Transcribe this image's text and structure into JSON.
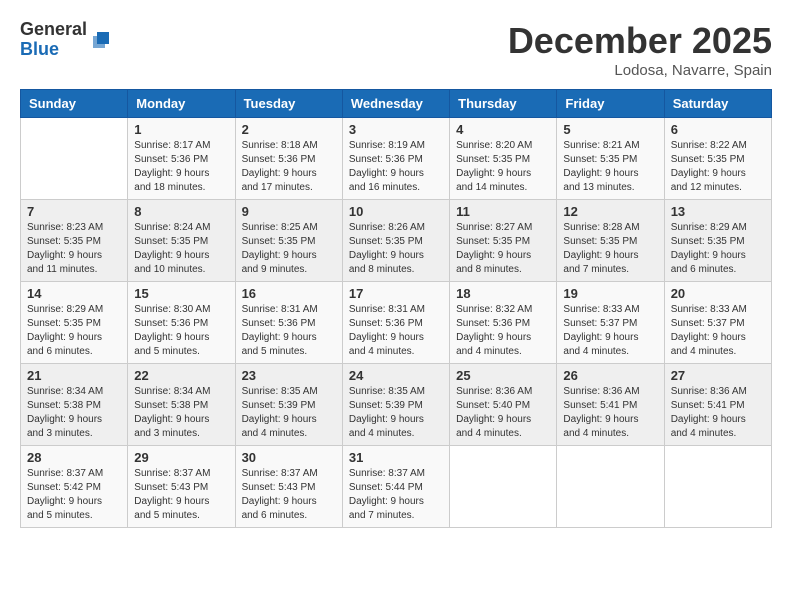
{
  "logo": {
    "general": "General",
    "blue": "Blue"
  },
  "title": "December 2025",
  "location": "Lodosa, Navarre, Spain",
  "days_of_week": [
    "Sunday",
    "Monday",
    "Tuesday",
    "Wednesday",
    "Thursday",
    "Friday",
    "Saturday"
  ],
  "weeks": [
    [
      {
        "day": "",
        "info": ""
      },
      {
        "day": "1",
        "info": "Sunrise: 8:17 AM\nSunset: 5:36 PM\nDaylight: 9 hours\nand 18 minutes."
      },
      {
        "day": "2",
        "info": "Sunrise: 8:18 AM\nSunset: 5:36 PM\nDaylight: 9 hours\nand 17 minutes."
      },
      {
        "day": "3",
        "info": "Sunrise: 8:19 AM\nSunset: 5:36 PM\nDaylight: 9 hours\nand 16 minutes."
      },
      {
        "day": "4",
        "info": "Sunrise: 8:20 AM\nSunset: 5:35 PM\nDaylight: 9 hours\nand 14 minutes."
      },
      {
        "day": "5",
        "info": "Sunrise: 8:21 AM\nSunset: 5:35 PM\nDaylight: 9 hours\nand 13 minutes."
      },
      {
        "day": "6",
        "info": "Sunrise: 8:22 AM\nSunset: 5:35 PM\nDaylight: 9 hours\nand 12 minutes."
      }
    ],
    [
      {
        "day": "7",
        "info": "Sunrise: 8:23 AM\nSunset: 5:35 PM\nDaylight: 9 hours\nand 11 minutes."
      },
      {
        "day": "8",
        "info": "Sunrise: 8:24 AM\nSunset: 5:35 PM\nDaylight: 9 hours\nand 10 minutes."
      },
      {
        "day": "9",
        "info": "Sunrise: 8:25 AM\nSunset: 5:35 PM\nDaylight: 9 hours\nand 9 minutes."
      },
      {
        "day": "10",
        "info": "Sunrise: 8:26 AM\nSunset: 5:35 PM\nDaylight: 9 hours\nand 8 minutes."
      },
      {
        "day": "11",
        "info": "Sunrise: 8:27 AM\nSunset: 5:35 PM\nDaylight: 9 hours\nand 8 minutes."
      },
      {
        "day": "12",
        "info": "Sunrise: 8:28 AM\nSunset: 5:35 PM\nDaylight: 9 hours\nand 7 minutes."
      },
      {
        "day": "13",
        "info": "Sunrise: 8:29 AM\nSunset: 5:35 PM\nDaylight: 9 hours\nand 6 minutes."
      }
    ],
    [
      {
        "day": "14",
        "info": "Sunrise: 8:29 AM\nSunset: 5:35 PM\nDaylight: 9 hours\nand 6 minutes."
      },
      {
        "day": "15",
        "info": "Sunrise: 8:30 AM\nSunset: 5:36 PM\nDaylight: 9 hours\nand 5 minutes."
      },
      {
        "day": "16",
        "info": "Sunrise: 8:31 AM\nSunset: 5:36 PM\nDaylight: 9 hours\nand 5 minutes."
      },
      {
        "day": "17",
        "info": "Sunrise: 8:31 AM\nSunset: 5:36 PM\nDaylight: 9 hours\nand 4 minutes."
      },
      {
        "day": "18",
        "info": "Sunrise: 8:32 AM\nSunset: 5:36 PM\nDaylight: 9 hours\nand 4 minutes."
      },
      {
        "day": "19",
        "info": "Sunrise: 8:33 AM\nSunset: 5:37 PM\nDaylight: 9 hours\nand 4 minutes."
      },
      {
        "day": "20",
        "info": "Sunrise: 8:33 AM\nSunset: 5:37 PM\nDaylight: 9 hours\nand 4 minutes."
      }
    ],
    [
      {
        "day": "21",
        "info": "Sunrise: 8:34 AM\nSunset: 5:38 PM\nDaylight: 9 hours\nand 3 minutes."
      },
      {
        "day": "22",
        "info": "Sunrise: 8:34 AM\nSunset: 5:38 PM\nDaylight: 9 hours\nand 3 minutes."
      },
      {
        "day": "23",
        "info": "Sunrise: 8:35 AM\nSunset: 5:39 PM\nDaylight: 9 hours\nand 4 minutes."
      },
      {
        "day": "24",
        "info": "Sunrise: 8:35 AM\nSunset: 5:39 PM\nDaylight: 9 hours\nand 4 minutes."
      },
      {
        "day": "25",
        "info": "Sunrise: 8:36 AM\nSunset: 5:40 PM\nDaylight: 9 hours\nand 4 minutes."
      },
      {
        "day": "26",
        "info": "Sunrise: 8:36 AM\nSunset: 5:41 PM\nDaylight: 9 hours\nand 4 minutes."
      },
      {
        "day": "27",
        "info": "Sunrise: 8:36 AM\nSunset: 5:41 PM\nDaylight: 9 hours\nand 4 minutes."
      }
    ],
    [
      {
        "day": "28",
        "info": "Sunrise: 8:37 AM\nSunset: 5:42 PM\nDaylight: 9 hours\nand 5 minutes."
      },
      {
        "day": "29",
        "info": "Sunrise: 8:37 AM\nSunset: 5:43 PM\nDaylight: 9 hours\nand 5 minutes."
      },
      {
        "day": "30",
        "info": "Sunrise: 8:37 AM\nSunset: 5:43 PM\nDaylight: 9 hours\nand 6 minutes."
      },
      {
        "day": "31",
        "info": "Sunrise: 8:37 AM\nSunset: 5:44 PM\nDaylight: 9 hours\nand 7 minutes."
      },
      {
        "day": "",
        "info": ""
      },
      {
        "day": "",
        "info": ""
      },
      {
        "day": "",
        "info": ""
      }
    ]
  ]
}
